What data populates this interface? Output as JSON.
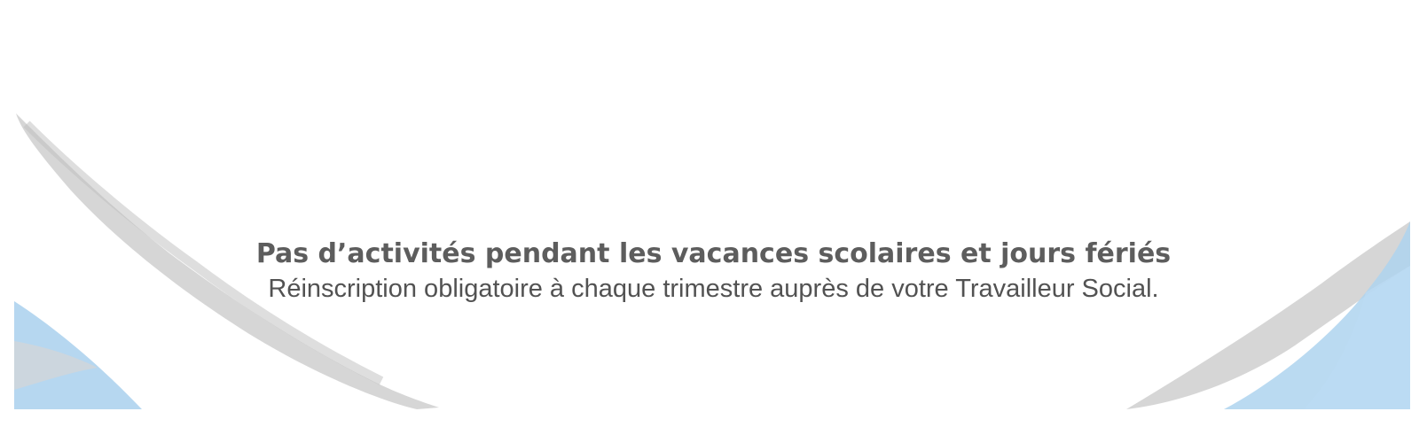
{
  "notice": {
    "headline": "Pas d’activités pendant les vacances scolaires et jours fériés",
    "subline": "Réinscription obligatoire à chaque trimestre auprès de votre Travailleur Social."
  },
  "colors": {
    "text": "#5d5d5d",
    "brush_grey": "#c9c9c9",
    "brush_blue": "#a8cfea"
  }
}
